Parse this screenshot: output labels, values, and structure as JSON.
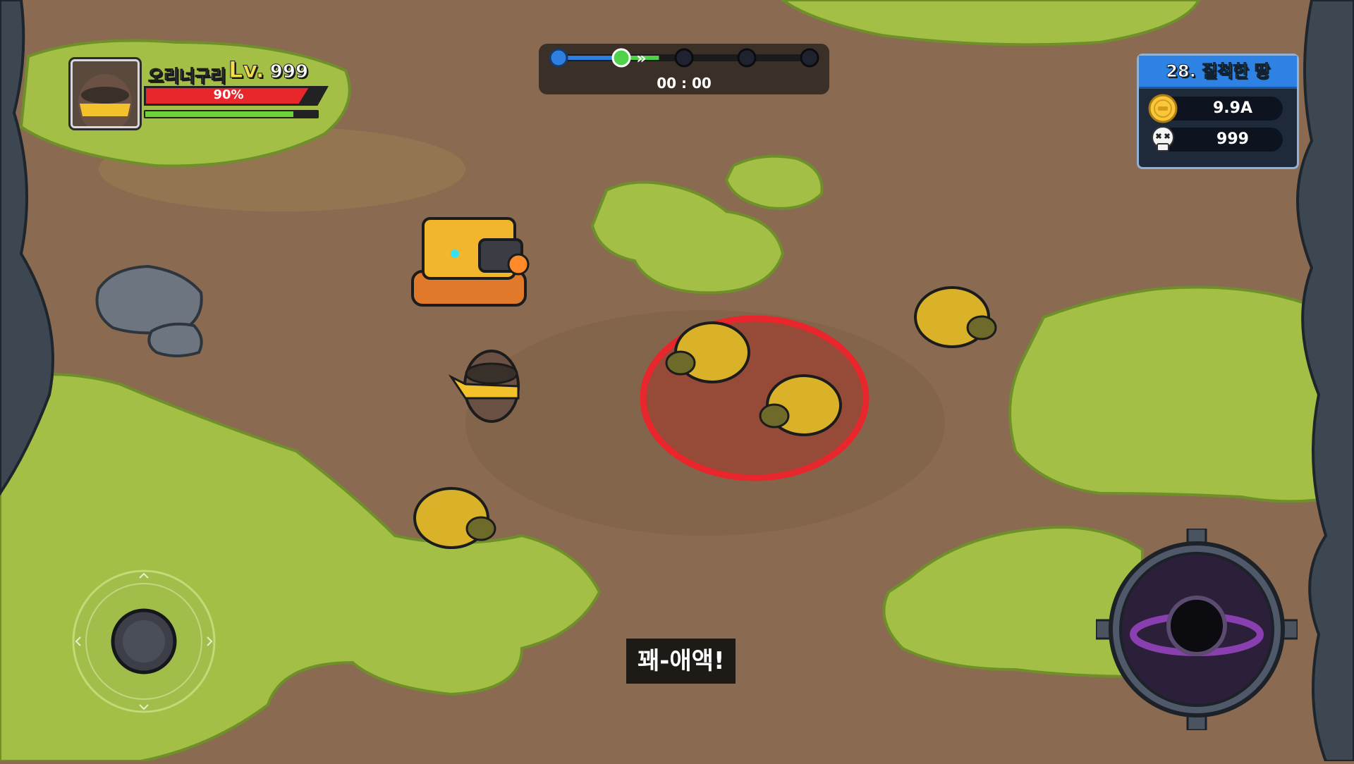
{
  "player": {
    "name": "오리너구리",
    "level_label": "Lv.",
    "level": "999",
    "hp_text": "90%",
    "hp_fraction": 0.9,
    "xp_fraction": 0.86
  },
  "wave": {
    "timer": "00 : 00",
    "nodes_total": 5,
    "nodes_reached": 2
  },
  "stage": {
    "title": "28. 질척한 땅",
    "gold": "9.9A",
    "kills": "999"
  },
  "dialogue": {
    "text": "꽤-애액!"
  },
  "colors": {
    "ground": "#8a6b52",
    "grass": "#a3bf45",
    "hp": "#e8262b",
    "xp": "#6ed23a",
    "stage_header": "#2e82e4",
    "target_ring": "#e8262b"
  },
  "icons": [
    "gold-coin-icon",
    "skull-icon",
    "joystick-icon",
    "black-hole-skill-icon"
  ]
}
